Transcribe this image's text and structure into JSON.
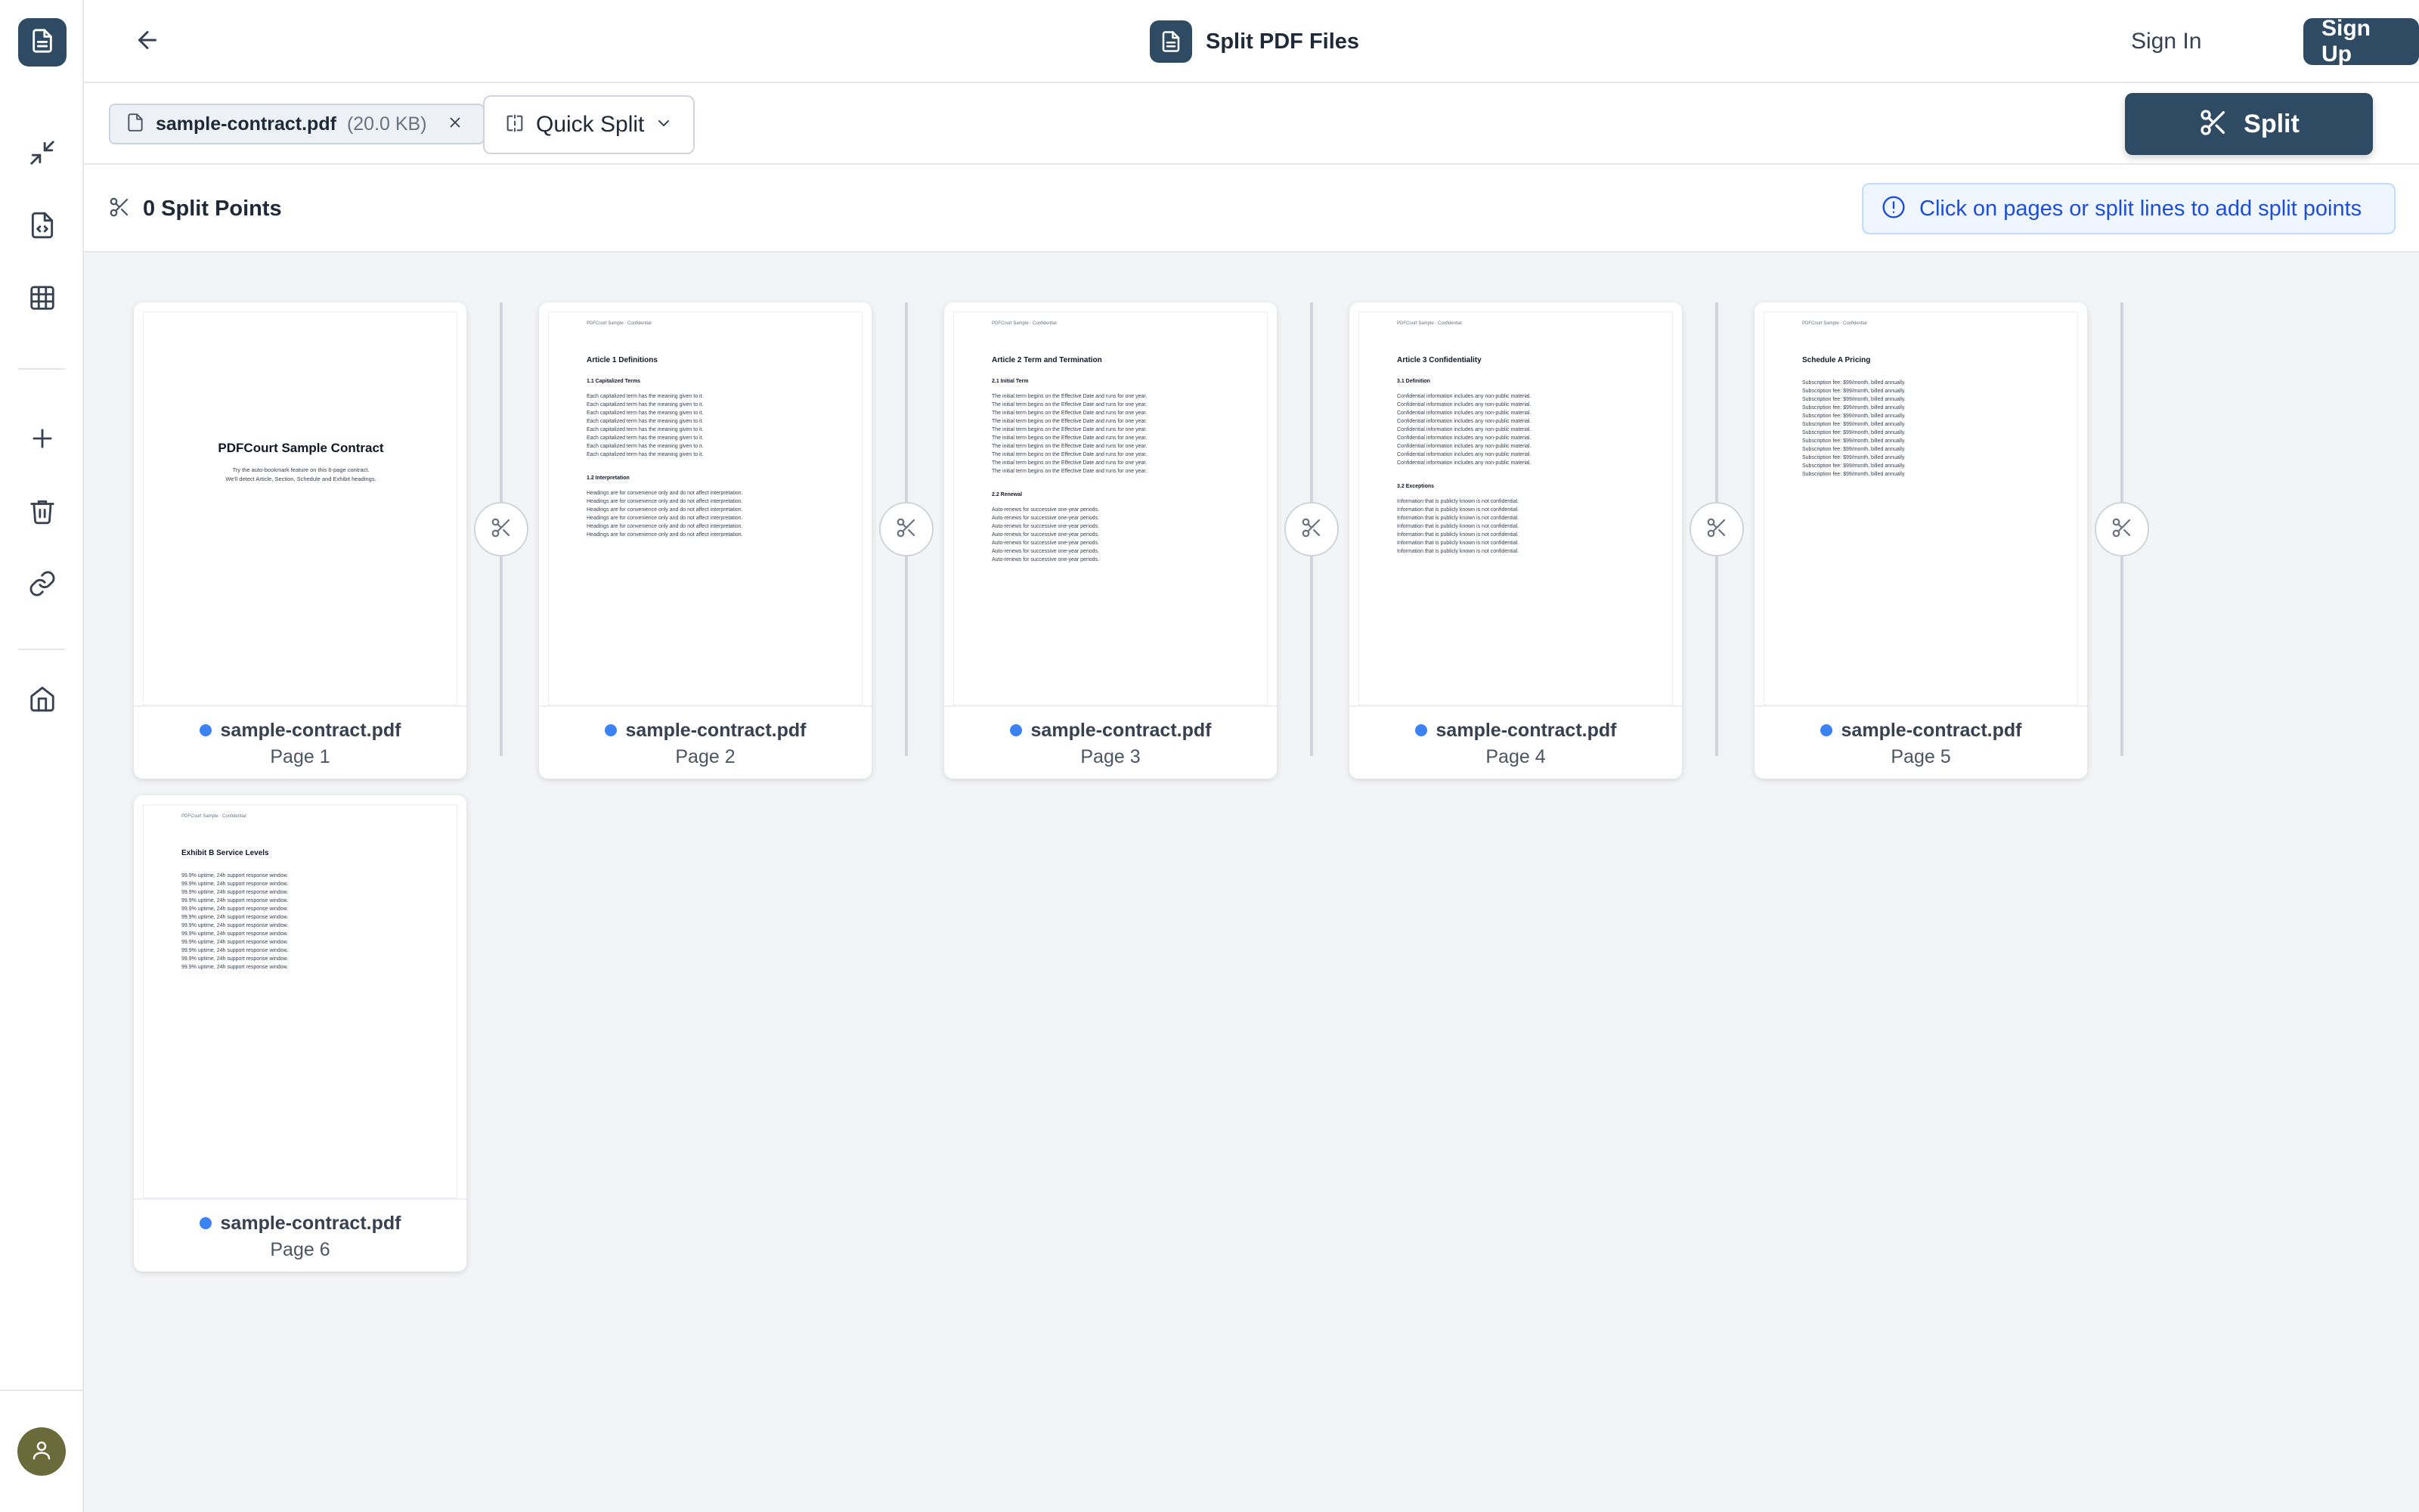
{
  "header": {
    "title": "Split PDF Files",
    "sign_in": "Sign In",
    "sign_up": "Sign Up"
  },
  "toolbar": {
    "file_name": "sample-contract.pdf",
    "file_size": "(20.0 KB)",
    "mode_label": "Quick Split",
    "split_label": "Split"
  },
  "points": {
    "label": "0 Split Points",
    "hint": "Click on pages or split lines to add split points"
  },
  "colors": {
    "primary": "#2f4a63",
    "accent_dot": "#3b82f6",
    "info_text": "#1d4ed8"
  },
  "pages": [
    {
      "file": "sample-contract.pdf",
      "label": "Page 1",
      "cover_title": "PDFCourt Sample Contract",
      "cover_lines": [
        "Try the auto-bookmark feature on this 6-page contract.",
        "We'll detect Article, Section, Schedule and Exhibit headings."
      ]
    },
    {
      "file": "sample-contract.pdf",
      "label": "Page 2",
      "header": "PDFCourt Sample · Confidential",
      "heading": "Article 1  Definitions",
      "sections": [
        {
          "title": "1.1  Capitalized Terms",
          "lines": [
            "Each capitalized term has the meaning given to it.",
            "Each capitalized term has the meaning given to it.",
            "Each capitalized term has the meaning given to it.",
            "Each capitalized term has the meaning given to it.",
            "Each capitalized term has the meaning given to it.",
            "Each capitalized term has the meaning given to it.",
            "Each capitalized term has the meaning given to it.",
            "Each capitalized term has the meaning given to it."
          ]
        },
        {
          "title": "1.2  Interpretation",
          "lines": [
            "Headings are for convenience only and do not affect interpretation.",
            "Headings are for convenience only and do not affect interpretation.",
            "Headings are for convenience only and do not affect interpretation.",
            "Headings are for convenience only and do not affect interpretation.",
            "Headings are for convenience only and do not affect interpretation.",
            "Headings are for convenience only and do not affect interpretation."
          ]
        }
      ]
    },
    {
      "file": "sample-contract.pdf",
      "label": "Page 3",
      "header": "PDFCourt Sample · Confidential",
      "heading": "Article 2  Term and Termination",
      "sections": [
        {
          "title": "2.1  Initial Term",
          "lines": [
            "The initial term begins on the Effective Date and runs for one year.",
            "The initial term begins on the Effective Date and runs for one year.",
            "The initial term begins on the Effective Date and runs for one year.",
            "The initial term begins on the Effective Date and runs for one year.",
            "The initial term begins on the Effective Date and runs for one year.",
            "The initial term begins on the Effective Date and runs for one year.",
            "The initial term begins on the Effective Date and runs for one year.",
            "The initial term begins on the Effective Date and runs for one year.",
            "The initial term begins on the Effective Date and runs for one year.",
            "The initial term begins on the Effective Date and runs for one year."
          ]
        },
        {
          "title": "2.2  Renewal",
          "lines": [
            "Auto-renews for successive one-year periods.",
            "Auto-renews for successive one-year periods.",
            "Auto-renews for successive one-year periods.",
            "Auto-renews for successive one-year periods.",
            "Auto-renews for successive one-year periods.",
            "Auto-renews for successive one-year periods.",
            "Auto-renews for successive one-year periods."
          ]
        }
      ]
    },
    {
      "file": "sample-contract.pdf",
      "label": "Page 4",
      "header": "PDFCourt Sample · Confidential",
      "heading": "Article 3  Confidentiality",
      "sections": [
        {
          "title": "3.1  Definition",
          "lines": [
            "Confidential information includes any non-public material.",
            "Confidential information includes any non-public material.",
            "Confidential information includes any non-public material.",
            "Confidential information includes any non-public material.",
            "Confidential information includes any non-public material.",
            "Confidential information includes any non-public material.",
            "Confidential information includes any non-public material.",
            "Confidential information includes any non-public material.",
            "Confidential information includes any non-public material."
          ]
        },
        {
          "title": "3.2  Exceptions",
          "lines": [
            "Information that is publicly known is not confidential.",
            "Information that is publicly known is not confidential.",
            "Information that is publicly known is not confidential.",
            "Information that is publicly known is not confidential.",
            "Information that is publicly known is not confidential.",
            "Information that is publicly known is not confidential.",
            "Information that is publicly known is not confidential."
          ]
        }
      ]
    },
    {
      "file": "sample-contract.pdf",
      "label": "Page 5",
      "header": "PDFCourt Sample · Confidential",
      "heading": "Schedule A  Pricing",
      "sections": [
        {
          "title": "",
          "lines": [
            "Subscription fee: $99/month, billed annually.",
            "Subscription fee: $99/month, billed annually.",
            "Subscription fee: $99/month, billed annually.",
            "Subscription fee: $99/month, billed annually.",
            "Subscription fee: $99/month, billed annually.",
            "Subscription fee: $99/month, billed annually.",
            "Subscription fee: $99/month, billed annually.",
            "Subscription fee: $99/month, billed annually.",
            "Subscription fee: $99/month, billed annually.",
            "Subscription fee: $99/month, billed annually.",
            "Subscription fee: $99/month, billed annually.",
            "Subscription fee: $99/month, billed annually."
          ]
        }
      ]
    },
    {
      "file": "sample-contract.pdf",
      "label": "Page 6",
      "header": "PDFCourt Sample · Confidential",
      "heading": "Exhibit B  Service Levels",
      "sections": [
        {
          "title": "",
          "lines": [
            "99.9% uptime, 24h support response window.",
            "99.9% uptime, 24h support response window.",
            "99.9% uptime, 24h support response window.",
            "99.9% uptime, 24h support response window.",
            "99.9% uptime, 24h support response window.",
            "99.9% uptime, 24h support response window.",
            "99.9% uptime, 24h support response window.",
            "99.9% uptime, 24h support response window.",
            "99.9% uptime, 24h support response window.",
            "99.9% uptime, 24h support response window.",
            "99.9% uptime, 24h support response window.",
            "99.9% uptime, 24h support response window."
          ]
        }
      ]
    }
  ]
}
